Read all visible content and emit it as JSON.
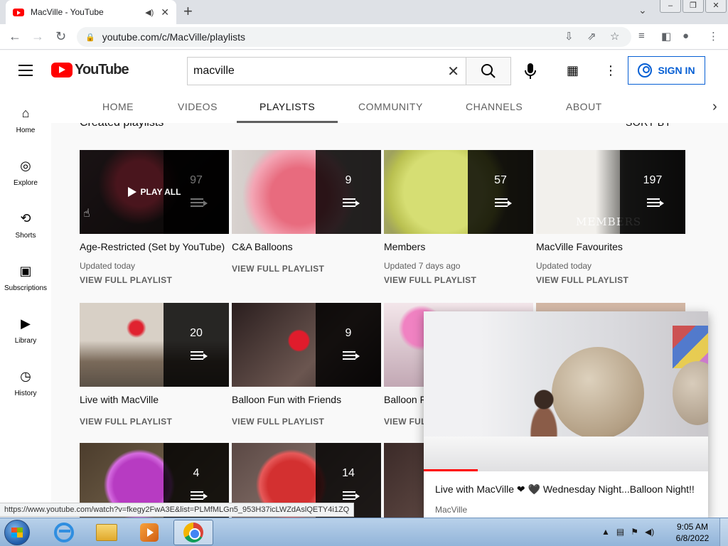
{
  "browser": {
    "tab_title": "MacVille - YouTube",
    "url": "youtube.com/c/MacVille/playlists",
    "status_url": "https://www.youtube.com/watch?v=fkegy2FwA3E&list=PLMfMLGn5_953H37icLWZdAslQETY4i1ZQ"
  },
  "youtube": {
    "logo_text": "YouTube",
    "search_query": "macville",
    "sign_in_label": "SIGN IN"
  },
  "sidebar": {
    "items": [
      {
        "label": "Home",
        "icon": "home-icon"
      },
      {
        "label": "Explore",
        "icon": "explore-icon"
      },
      {
        "label": "Shorts",
        "icon": "shorts-icon"
      },
      {
        "label": "Subscriptions",
        "icon": "subscriptions-icon"
      },
      {
        "label": "Library",
        "icon": "library-icon"
      },
      {
        "label": "History",
        "icon": "history-icon"
      }
    ]
  },
  "channel_tabs": [
    "HOME",
    "VIDEOS",
    "PLAYLISTS",
    "COMMUNITY",
    "CHANNELS",
    "ABOUT"
  ],
  "active_tab": "PLAYLISTS",
  "section": {
    "title": "Created playlists",
    "sort_label": "SORT BY"
  },
  "playlists": [
    {
      "title": "Age-Restricted (Set by YouTube)",
      "count": "97",
      "updated": "Updated today",
      "action": "VIEW FULL PLAYLIST",
      "hover_label": "PLAY ALL"
    },
    {
      "title": "C&A Balloons",
      "count": "9",
      "updated": "",
      "action": "VIEW FULL PLAYLIST"
    },
    {
      "title": "Members",
      "count": "57",
      "updated": "Updated 7 days ago",
      "action": "VIEW FULL PLAYLIST"
    },
    {
      "title": "MacVille Favourites",
      "count": "197",
      "updated": "Updated today",
      "action": "VIEW FULL PLAYLIST",
      "watermark": "MEMBERS"
    },
    {
      "title": "Live with MacVille",
      "count": "20",
      "updated": "",
      "action": "VIEW FULL PLAYLIST"
    },
    {
      "title": "Balloon Fun with Friends",
      "count": "9",
      "updated": "",
      "action": "VIEW FULL PLAYLIST"
    },
    {
      "title": "Balloon F",
      "count": "",
      "updated": "",
      "action": "VIEW FUL"
    },
    {
      "title": "",
      "count": "",
      "updated": "",
      "action": ""
    },
    {
      "title": "",
      "count": "4",
      "updated": "",
      "action": ""
    },
    {
      "title": "",
      "count": "14",
      "updated": "",
      "action": ""
    }
  ],
  "miniplayer": {
    "title": "Live with MacVille ❤ 🖤 Wednesday Night...Balloon Night!!",
    "channel": "MacVille",
    "progress_percent": 19
  },
  "taskbar": {
    "time": "9:05 AM",
    "date": "6/8/2022"
  }
}
